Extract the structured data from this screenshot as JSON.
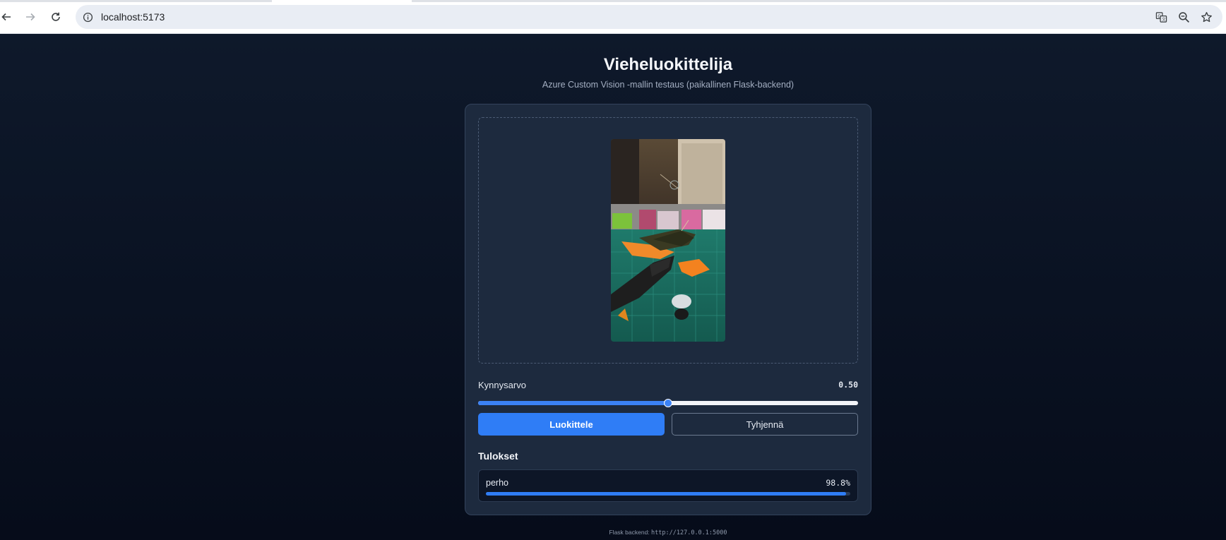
{
  "browser": {
    "url": "localhost:5173",
    "icons": [
      "back-arrow-icon",
      "forward-arrow-icon",
      "reload-icon",
      "site-info-icon",
      "translate-icon",
      "zoom-icon",
      "bookmark-star-icon"
    ]
  },
  "header": {
    "title": "Vieheluokittelija",
    "subtitle": "Azure Custom Vision -mallin testaus (paikallinen Flask-backend)"
  },
  "upload": {
    "preview_alt": "Uploaded lure image"
  },
  "threshold": {
    "label": "Kynnysarvo",
    "value_text": "0.50",
    "value": 0.5
  },
  "buttons": {
    "classify": "Luokittele",
    "clear": "Tyhjennä"
  },
  "results": {
    "title": "Tulokset",
    "items": [
      {
        "label": "perho",
        "probability_text": "98.8%",
        "probability": 0.988
      }
    ]
  },
  "footer": {
    "label": "Flask backend:",
    "url": "http://127.0.0.1:5000"
  },
  "colors": {
    "accent": "#2f7df6",
    "background": "#0a1222",
    "card": "#1d2a3e"
  }
}
